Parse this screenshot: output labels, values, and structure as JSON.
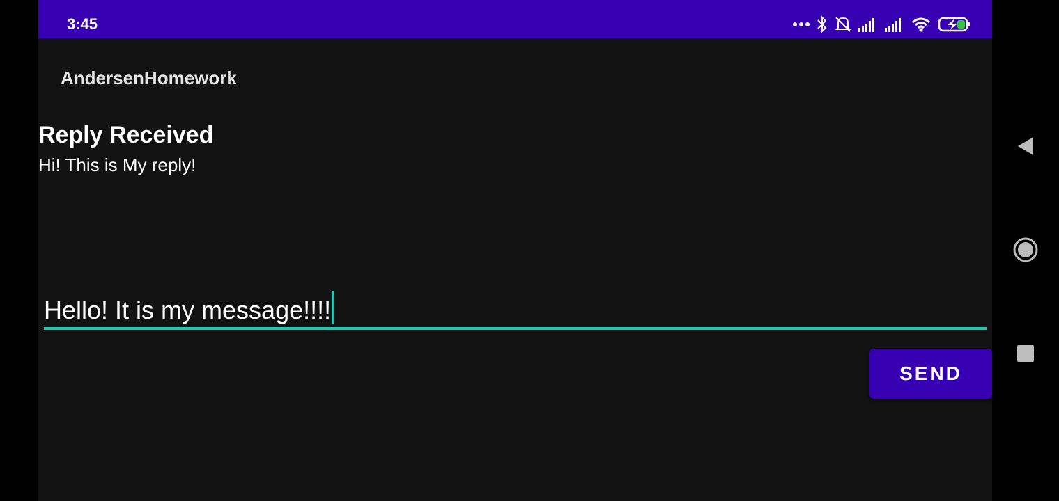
{
  "status_bar": {
    "time": "3:45",
    "icons": [
      "more-dots-icon",
      "bluetooth-icon",
      "do-not-disturb-icon",
      "signal-icon",
      "signal-icon",
      "wifi-icon",
      "battery-charging-icon"
    ],
    "color": "#3700b3"
  },
  "app_bar": {
    "title": "AndersenHomework"
  },
  "reply": {
    "heading": "Reply Received",
    "text": "Hi! This is My reply!"
  },
  "composer": {
    "message_value": "Hello! It is my message!!!!",
    "underline_color": "#1fc7b5",
    "send_label": "SEND"
  },
  "nav_bar": {
    "icons": [
      "back-icon",
      "home-icon",
      "recents-icon"
    ]
  }
}
